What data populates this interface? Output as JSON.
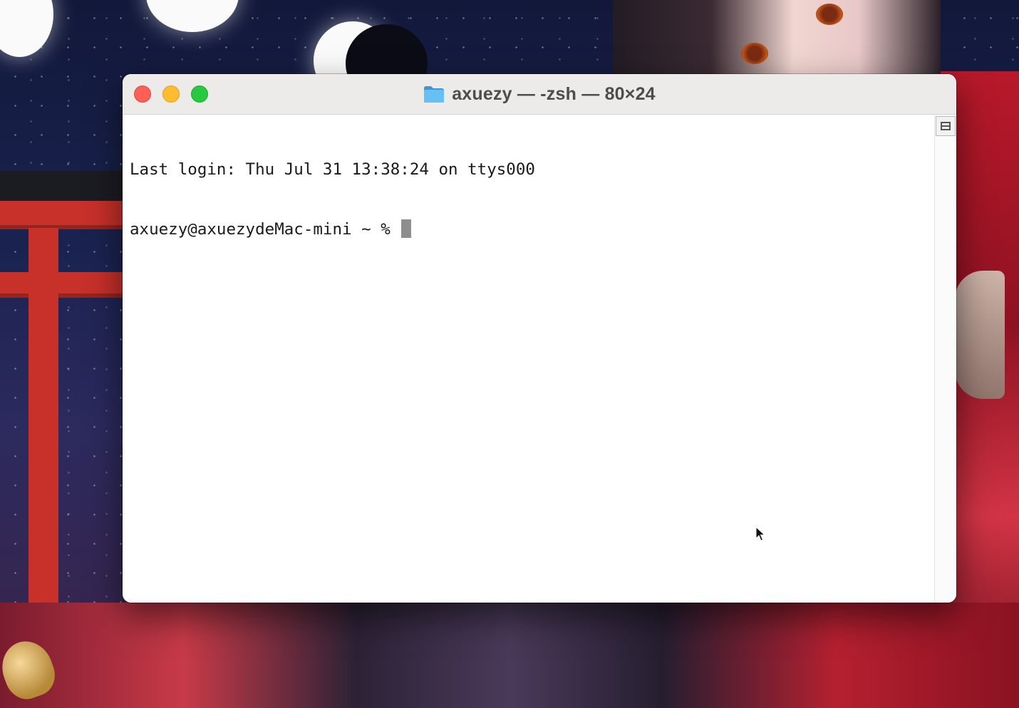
{
  "window": {
    "title": "axuezy — -zsh — 80×24",
    "folder_icon": "folder-icon",
    "buttons": {
      "close": "close-button",
      "minimize": "minimize-button",
      "zoom": "zoom-button"
    }
  },
  "terminal": {
    "lines": [
      "Last login: Thu Jul 31 13:38:24 on ttys000",
      "axuezy@axuezydeMac-mini ~ % "
    ]
  },
  "colors": {
    "close": "#fe5f57",
    "minimize": "#febc2e",
    "zoom": "#28c840",
    "folder": "#5bb7f0"
  }
}
